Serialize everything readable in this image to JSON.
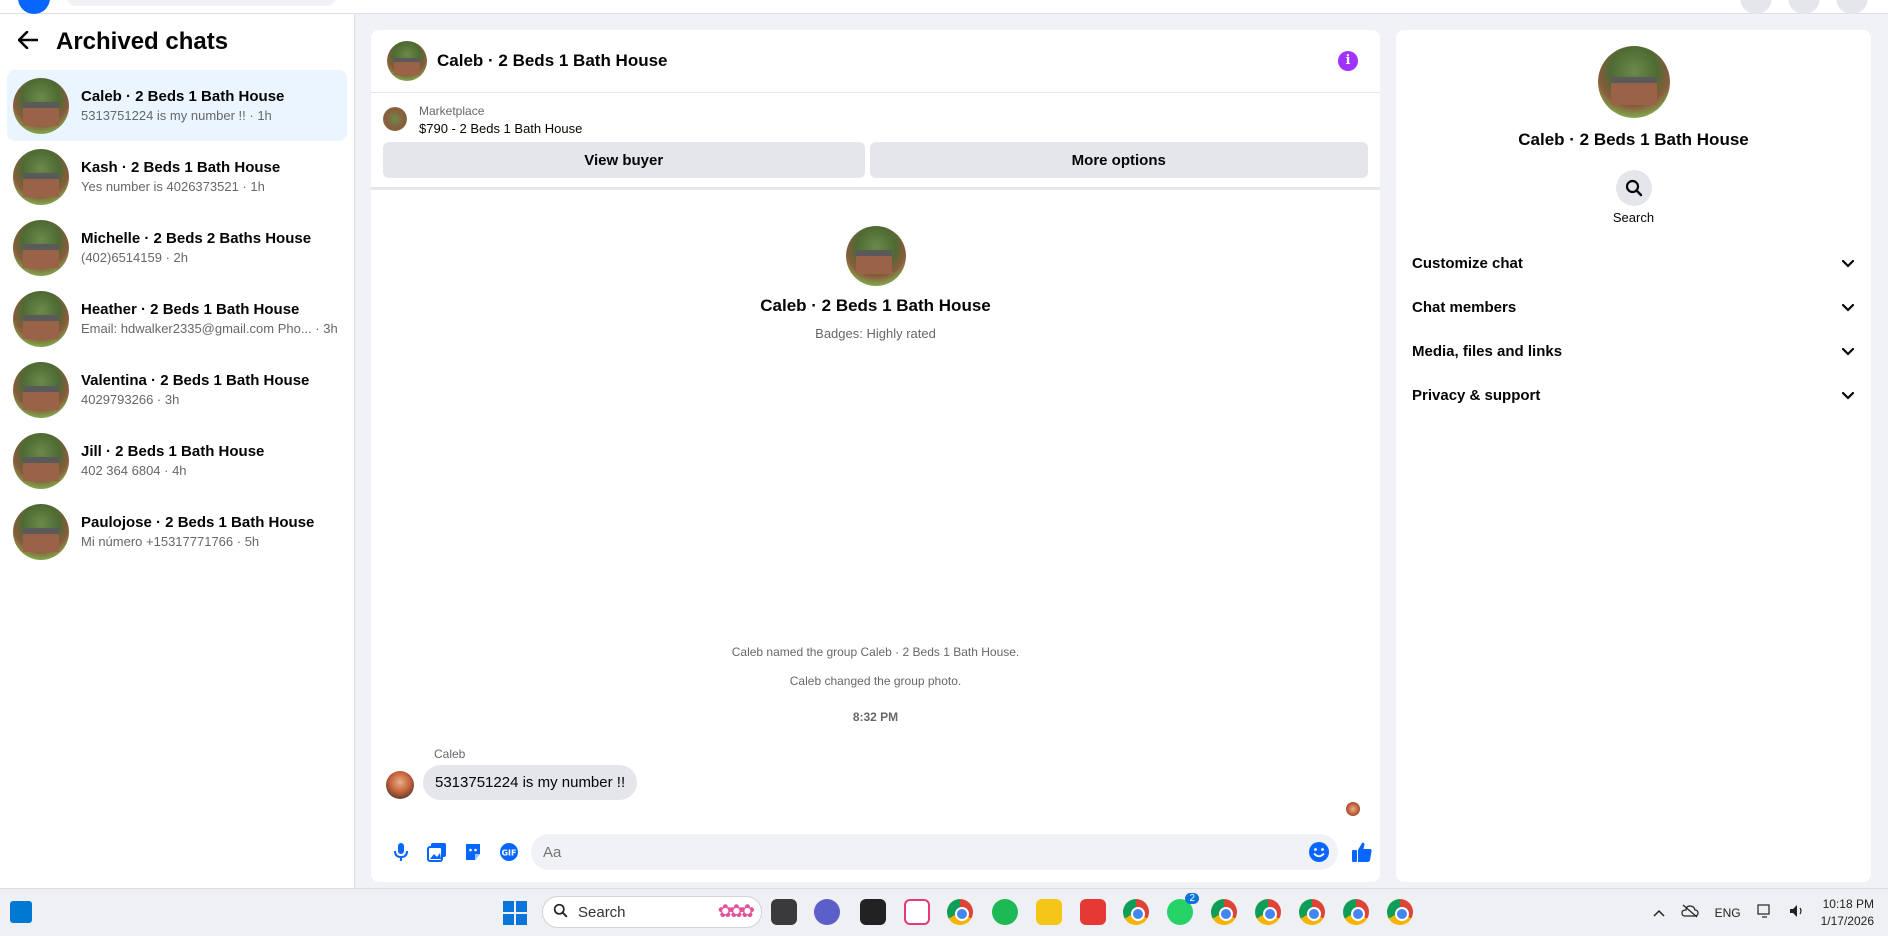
{
  "sidebar": {
    "title": "Archived chats",
    "chats": [
      {
        "name": "Caleb · 2 Beds 1 Bath House",
        "sub": "5313751224 is my number !! · 1h"
      },
      {
        "name": "Kash · 2 Beds 1 Bath House",
        "sub": "Yes number is 4026373521 · 1h"
      },
      {
        "name": "Michelle · 2 Beds 2 Baths House",
        "sub": "(402)6514159 · 2h"
      },
      {
        "name": "Heather · 2 Beds 1 Bath House",
        "sub": "Email: hdwalker2335@gmail.com Pho... · 3h"
      },
      {
        "name": "Valentina · 2 Beds 1 Bath House",
        "sub": "4029793266 · 3h"
      },
      {
        "name": "Jill · 2 Beds 1 Bath House",
        "sub": "402 364 6804 · 4h"
      },
      {
        "name": "Paulojose · 2 Beds 1 Bath House",
        "sub": "Mi número +15317771766 · 5h"
      }
    ]
  },
  "conversation": {
    "title": "Caleb · 2 Beds 1 Bath House",
    "info_glyph": "i",
    "listing": {
      "label": "Marketplace",
      "price_title": "$790 - 2 Beds 1 Bath House",
      "view_buyer": "View buyer",
      "more_options": "More options"
    },
    "intro": {
      "name": "Caleb · 2 Beds 1 Bath House",
      "badges": "Badges: Highly rated"
    },
    "system_1": "Caleb named the group Caleb · 2 Beds 1 Bath House.",
    "system_2": "Caleb changed the group photo.",
    "timestamp": "8:32 PM",
    "message": {
      "sender": "Caleb",
      "text": "5313751224 is my number !!"
    },
    "composer": {
      "placeholder": "Aa"
    }
  },
  "details": {
    "name": "Caleb · 2 Beds 1 Bath House",
    "search_label": "Search",
    "sections": [
      "Customize chat",
      "Chat members",
      "Media, files and links",
      "Privacy & support"
    ]
  },
  "taskbar": {
    "search_label": "Search",
    "lang": "ENG",
    "time": "10:18 PM",
    "date": "1/17/2026",
    "badge_whatsapp": "2"
  },
  "colors": {
    "accent": "#0866ff",
    "info": "#a033ff",
    "active_row": "#ebf5ff"
  }
}
